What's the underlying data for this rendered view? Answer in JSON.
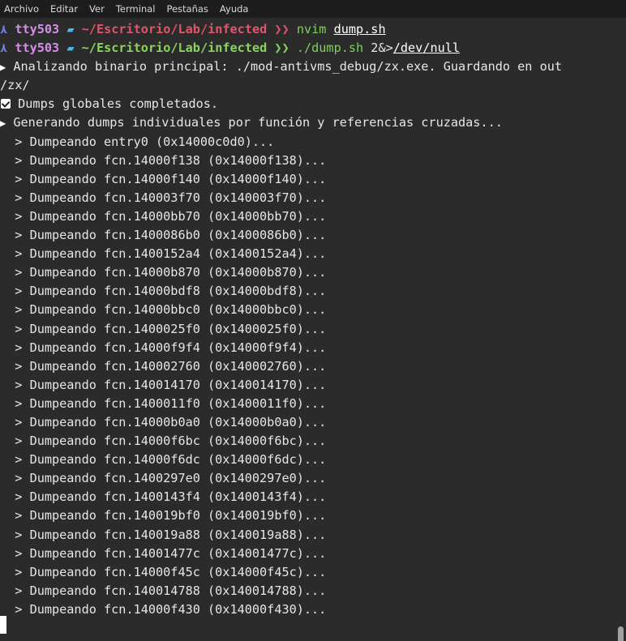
{
  "menu": {
    "items": [
      "Archivo",
      "Editar",
      "Ver",
      "Terminal",
      "Pestañas",
      "Ayuda"
    ]
  },
  "prompts": [
    {
      "arch_icon": "⋏",
      "user": "tty503",
      "folder_icon": "folder-icon",
      "path": "~/Escritorio/Lab/infected",
      "chevron": "❯❯",
      "command": "nvim",
      "args": [
        "dump.sh"
      ]
    },
    {
      "arch_icon": "⋏",
      "user": "tty503",
      "folder_icon": "folder-icon",
      "path": "~/Escritorio/Lab/infected",
      "chevron": "❯❯",
      "command": "./dump.sh",
      "plain": " 2&>",
      "args": [
        "/dev/null"
      ]
    }
  ],
  "output": {
    "analyzing_line1": "Analizando binario principal: ./mod-antivms_debug/zx.exe. Guardando en out",
    "analyzing_line2": "/zx/",
    "globals_done": " Dumps globales completados.",
    "generating": "Generando dumps individuales por función y referencias cruzadas...",
    "dump_lines": [
      "  > Dumpeando entry0 (0x14000c0d0)...",
      "  > Dumpeando fcn.14000f138 (0x14000f138)...",
      "  > Dumpeando fcn.14000f140 (0x14000f140)...",
      "  > Dumpeando fcn.140003f70 (0x140003f70)...",
      "  > Dumpeando fcn.14000bb70 (0x14000bb70)...",
      "  > Dumpeando fcn.1400086b0 (0x1400086b0)...",
      "  > Dumpeando fcn.1400152a4 (0x1400152a4)...",
      "  > Dumpeando fcn.14000b870 (0x14000b870)...",
      "  > Dumpeando fcn.14000bdf8 (0x14000bdf8)...",
      "  > Dumpeando fcn.14000bbc0 (0x14000bbc0)...",
      "  > Dumpeando fcn.1400025f0 (0x1400025f0)...",
      "  > Dumpeando fcn.14000f9f4 (0x14000f9f4)...",
      "  > Dumpeando fcn.140002760 (0x140002760)...",
      "  > Dumpeando fcn.140014170 (0x140014170)...",
      "  > Dumpeando fcn.1400011f0 (0x1400011f0)...",
      "  > Dumpeando fcn.14000b0a0 (0x14000b0a0)...",
      "  > Dumpeando fcn.14000f6bc (0x14000f6bc)...",
      "  > Dumpeando fcn.14000f6dc (0x14000f6dc)...",
      "  > Dumpeando fcn.1400297e0 (0x1400297e0)...",
      "  > Dumpeando fcn.1400143f4 (0x1400143f4)...",
      "  > Dumpeando fcn.140019bf0 (0x140019bf0)...",
      "  > Dumpeando fcn.140019a88 (0x140019a88)...",
      "  > Dumpeando fcn.14001477c (0x14001477c)...",
      "  > Dumpeando fcn.14000f45c (0x14000f45c)...",
      "  > Dumpeando fcn.140014788 (0x140014788)...",
      "  > Dumpeando fcn.14000f430 (0x14000f430)..."
    ]
  },
  "icons": {
    "triangle": "▶",
    "checkbox": "checkbox-icon"
  },
  "colors": {
    "background": "#2b2b2b",
    "menubar": "#1d1d1d",
    "user": "#d58ee8",
    "path_first": "#e0556b",
    "path_second": "#8bd35f",
    "folder": "#4fb6e8",
    "arch": "#6c7ef0"
  }
}
